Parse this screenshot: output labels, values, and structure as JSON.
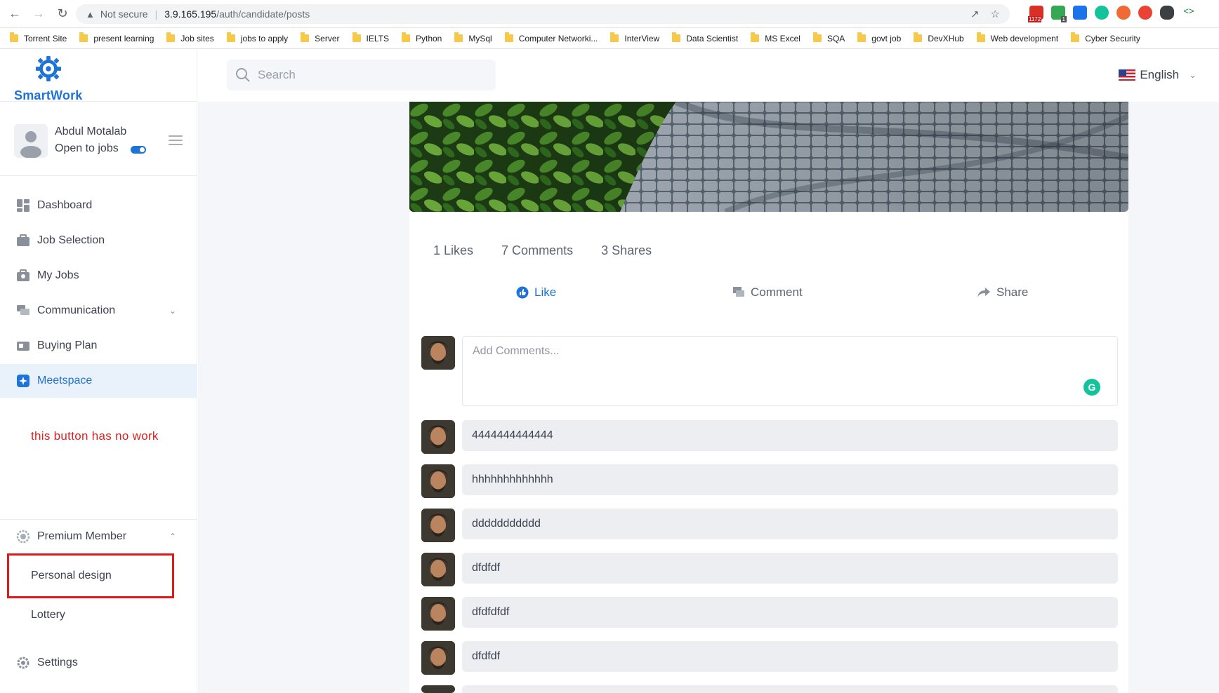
{
  "browser": {
    "security_label": "Not secure",
    "url_host": "3.9.165.195",
    "url_path": "/auth/candidate/posts",
    "gmail_badge": "1172",
    "ext_badge": "1"
  },
  "bookmarks": [
    "Torrent Site",
    "present learning",
    "Job sites",
    "jobs to apply",
    "Server",
    "IELTS",
    "Python",
    "MySql",
    "Computer Networki...",
    "InterView",
    "Data Scientist",
    "MS Excel",
    "SQA",
    "govt job",
    "DevXHub",
    "Web development",
    "Cyber Security"
  ],
  "app": {
    "logo_text": "SmartWork"
  },
  "profile": {
    "name": "Abdul Motalab",
    "status": "Open to jobs"
  },
  "sidebar": {
    "items": [
      {
        "label": "Dashboard",
        "icon": "dashboard-icon"
      },
      {
        "label": "Job Selection",
        "icon": "briefcase-icon"
      },
      {
        "label": "My Jobs",
        "icon": "my-jobs-icon"
      },
      {
        "label": "Communication",
        "icon": "chat-icon"
      },
      {
        "label": "Buying Plan",
        "icon": "plan-icon"
      },
      {
        "label": "Meetspace",
        "icon": "meetspace-icon"
      }
    ],
    "annotation": "this button has no work",
    "premium_label": "Premium Member",
    "sub_items": [
      "Personal design",
      "Lottery"
    ],
    "settings_label": "Settings"
  },
  "topbar": {
    "search_placeholder": "Search",
    "language": "English"
  },
  "post": {
    "likes": "1 Likes",
    "comments": "7 Comments",
    "shares": "3 Shares",
    "like_label": "Like",
    "comment_label": "Comment",
    "share_label": "Share",
    "comment_placeholder": "Add Comments...",
    "comment_list": [
      "4444444444444",
      "hhhhhhhhhhhhh",
      "ddddddddddd",
      "dfdfdf",
      "dfdfdfdf",
      "dfdfdf"
    ]
  },
  "colors": {
    "accent": "#1e73d8",
    "annotation_red": "#e02020"
  }
}
